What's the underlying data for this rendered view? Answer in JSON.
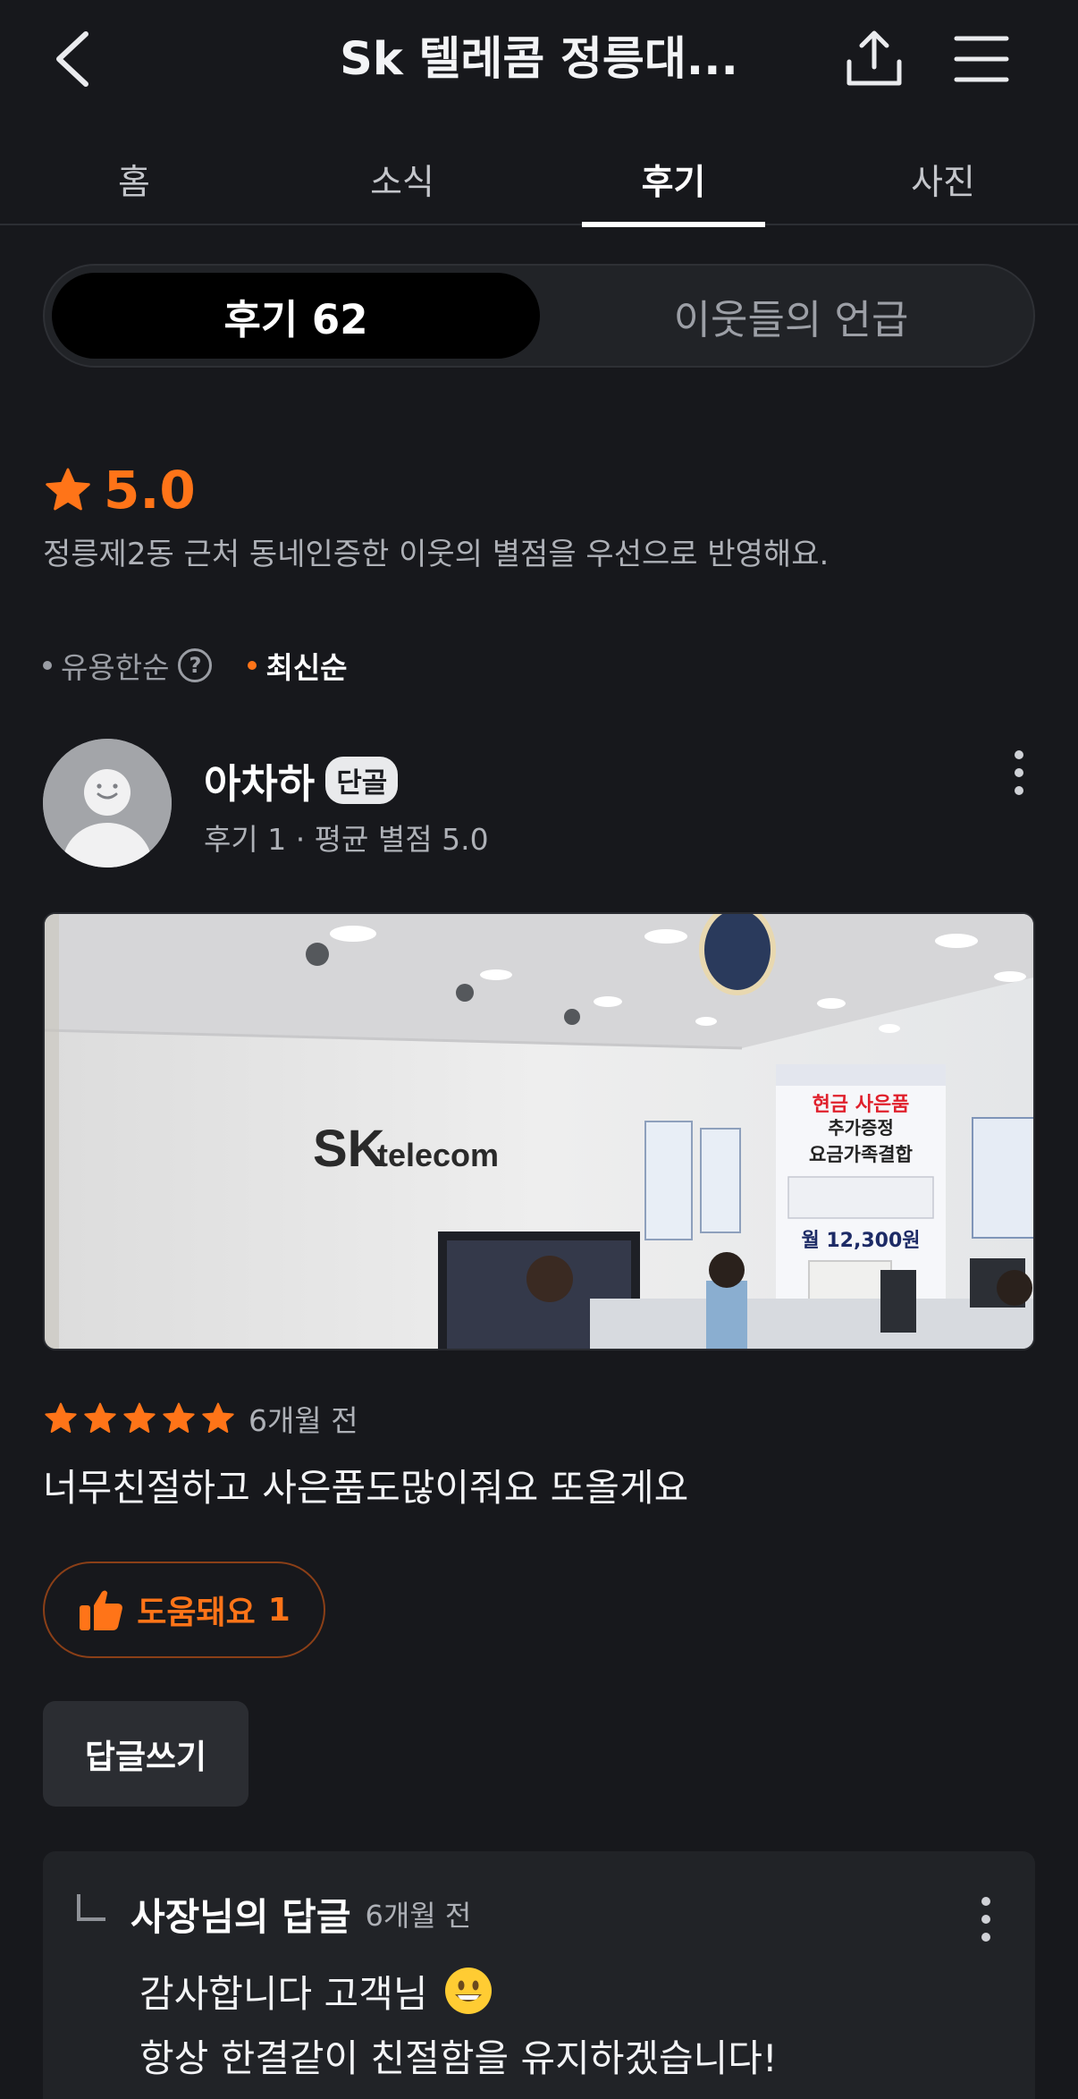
{
  "header": {
    "title": "Sk 텔레콤 정릉대...",
    "back_icon": "chevron-left-icon",
    "share_icon": "share-icon",
    "menu_icon": "hamburger-menu-icon"
  },
  "tabs": [
    {
      "label": "홈",
      "active": false
    },
    {
      "label": "소식",
      "active": false
    },
    {
      "label": "후기",
      "active": true
    },
    {
      "label": "사진",
      "active": false
    }
  ],
  "segment": {
    "reviews_label": "후기 62",
    "mentions_label": "이웃들의 언급"
  },
  "rating": {
    "value": "5.0",
    "description": "정릉제2동 근처 동네인증한 이웃의 별점을 우선으로 반영해요."
  },
  "sort": {
    "helpful_label": "유용한순",
    "latest_label": "최신순"
  },
  "review": {
    "reviewer_name": "아차하",
    "badge": "단골",
    "meta": "후기 1 · 평균 별점 5.0",
    "stars": 5,
    "time": "6개월 전",
    "text": "너무친절하고 사은품도많이줘요 또올게요",
    "helpful_label": "도움돼요",
    "helpful_count": "1",
    "reply_button_label": "답글쓰기",
    "photo": {
      "wall_logo_sk": "SK",
      "wall_logo_telecom": "telecom",
      "poster_line1": "현금 사은품",
      "poster_line2": "추가증정",
      "poster_line3": "요금가족결합",
      "poster_price": "월 12,300원"
    }
  },
  "owner_reply": {
    "title": "사장님의 답글",
    "time": "6개월 전",
    "line1": "감사합니다 고객님",
    "line2": "항상 한결같이 친절함을 유지하겠습니다!"
  },
  "colors": {
    "accent": "#ff7418",
    "background": "#17181c"
  }
}
